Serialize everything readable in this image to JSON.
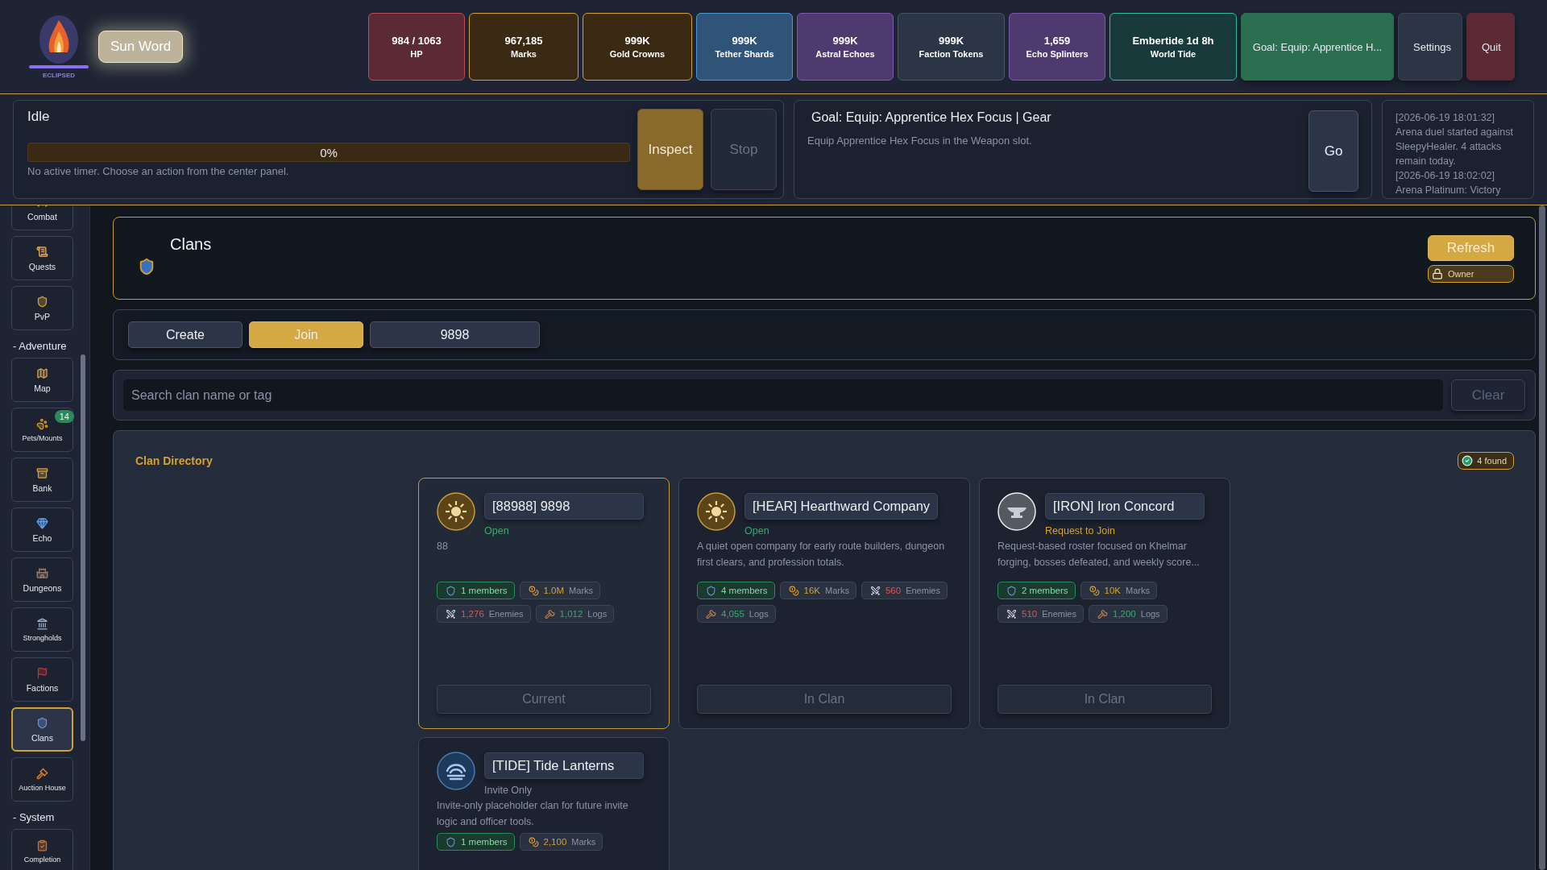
{
  "brand": {
    "caption": "ECLIPSED"
  },
  "sun_word": "Sun Word",
  "stats": [
    {
      "kind": "hp",
      "value": "984 / 1063",
      "label": "HP"
    },
    {
      "kind": "gold",
      "value": "967,185",
      "label": "Marks"
    },
    {
      "kind": "gold",
      "value": "999K",
      "label": "Gold Crowns"
    },
    {
      "kind": "blue",
      "value": "999K",
      "label": "Tether Shards"
    },
    {
      "kind": "purple",
      "value": "999K",
      "label": "Astral Echoes"
    },
    {
      "kind": "slate",
      "value": "999K",
      "label": "Faction Tokens"
    },
    {
      "kind": "purple",
      "value": "1,659",
      "label": "Echo Splinters"
    },
    {
      "kind": "teal",
      "value": "Embertide 1d 8h",
      "label": "World Tide"
    }
  ],
  "top_buttons": [
    {
      "kind": "goal",
      "label": "Goal: Equip: Apprentice H..."
    },
    {
      "kind": "plain",
      "label": "Settings"
    },
    {
      "kind": "danger",
      "label": "Quit"
    }
  ],
  "activity": {
    "title": "Idle",
    "level": 0,
    "reading": "0%",
    "hint": "No active timer. Choose an action from the center panel.",
    "buttons": [
      {
        "label": "Inspect",
        "disabled": false
      },
      {
        "label": "Stop",
        "disabled": true
      }
    ]
  },
  "goal": {
    "title": "Goal: Equip: Apprentice Hex Focus | Gear",
    "text": "Equip Apprentice Hex Focus in the Weapon slot.",
    "button": "Go"
  },
  "log": [
    "[2026-06-19 18:01:32]",
    "Arena duel started against SleepyHealer. 4 attacks remain today.",
    "[2026-06-19 18:02:02]",
    "Arena Platinum: Victory"
  ],
  "sidebar": [
    {
      "kind": "item",
      "label": "Combat",
      "selected": false
    },
    {
      "kind": "item",
      "label": "Quests",
      "selected": false
    },
    {
      "kind": "item",
      "label": "PvP",
      "selected": false
    },
    {
      "kind": "section",
      "label": "- Adventure"
    },
    {
      "kind": "item",
      "label": "Map",
      "selected": false
    },
    {
      "kind": "item",
      "label": "Pets/Mounts",
      "selected": false,
      "badge": "14"
    },
    {
      "kind": "item",
      "label": "Bank",
      "selected": false
    },
    {
      "kind": "item",
      "label": "Echo",
      "selected": false
    },
    {
      "kind": "item",
      "label": "Dungeons",
      "selected": false
    },
    {
      "kind": "item",
      "label": "Strongholds",
      "selected": false
    },
    {
      "kind": "item",
      "label": "Factions",
      "selected": false
    },
    {
      "kind": "item",
      "label": "Clans",
      "selected": true
    },
    {
      "kind": "item",
      "label": "Auction House",
      "selected": false
    },
    {
      "kind": "section",
      "label": "- System"
    },
    {
      "kind": "item",
      "label": "Completion",
      "selected": false
    }
  ],
  "page": {
    "title": "Clans",
    "refresh": "Refresh",
    "role": "Owner"
  },
  "tabs": [
    {
      "label": "Create",
      "selected": false
    },
    {
      "label": "Join",
      "selected": true
    },
    {
      "label": "9898",
      "selected": false
    }
  ],
  "search": {
    "placeholder": "Search clan name or tag",
    "clear": "Clear"
  },
  "directory": {
    "title": "Clan Directory",
    "count": "4 found",
    "clans": [
      {
        "name": "[88988] 9898",
        "status": {
          "kind": "open",
          "label": "Open"
        },
        "description": "88",
        "selected": true,
        "button": "Current",
        "chips": [
          {
            "kind": "members",
            "value": "1 members"
          },
          {
            "kind": "marks",
            "value": "1.0M",
            "label": "Marks"
          },
          {
            "kind": "enemies",
            "value": "1,276",
            "label": "Enemies"
          },
          {
            "kind": "logs",
            "value": "1,012",
            "label": "Logs"
          }
        ]
      },
      {
        "name": "[HEAR] Hearthward Company",
        "status": {
          "kind": "open",
          "label": "Open"
        },
        "description": "A quiet open company for early route builders, dungeon first clears, and profession totals.",
        "selected": false,
        "button": "In Clan",
        "chips": [
          {
            "kind": "members",
            "value": "4 members"
          },
          {
            "kind": "marks",
            "value": "16K",
            "label": "Marks"
          },
          {
            "kind": "enemies",
            "value": "560",
            "label": "Enemies"
          },
          {
            "kind": "logs",
            "value": "4,055",
            "label": "Logs"
          }
        ]
      },
      {
        "name": "[IRON] Iron Concord",
        "status": {
          "kind": "request",
          "label": "Request to Join"
        },
        "description": "Request-based roster focused on Khelmar forging, bosses defeated, and weekly score...",
        "selected": false,
        "button": "In Clan",
        "chips": [
          {
            "kind": "members",
            "value": "2 members"
          },
          {
            "kind": "marks",
            "value": "10K",
            "label": "Marks"
          },
          {
            "kind": "enemies",
            "value": "510",
            "label": "Enemies"
          },
          {
            "kind": "logs",
            "value": "1,200",
            "label": "Logs"
          }
        ]
      },
      {
        "name": "[TIDE] Tide Lanterns",
        "status": {
          "kind": "invite",
          "label": "Invite Only"
        },
        "description": "Invite-only placeholder clan for future invite logic and officer tools.",
        "selected": false,
        "chips": [
          {
            "kind": "members",
            "value": "1 members"
          },
          {
            "kind": "marks",
            "value": "2,100",
            "label": "Marks"
          }
        ]
      }
    ]
  }
}
